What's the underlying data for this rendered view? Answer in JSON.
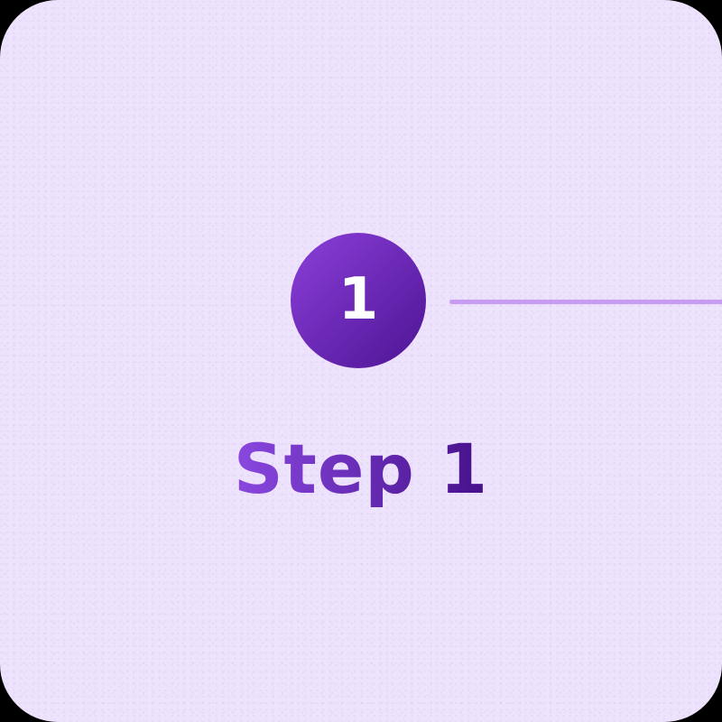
{
  "step": {
    "number": "1",
    "label": "Step 1"
  },
  "colors": {
    "card_background": "#eee3fc",
    "circle_gradient_start": "#8b3fd9",
    "circle_gradient_end": "#4d1494",
    "connector_line": "#c89cf3",
    "label_gradient_start": "#8a48e0",
    "label_gradient_end": "#45108a"
  }
}
